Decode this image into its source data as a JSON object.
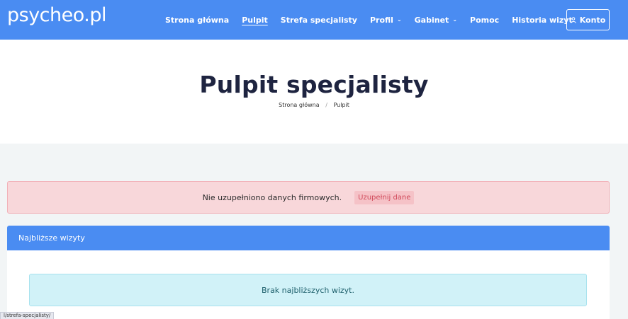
{
  "navbar": {
    "logo": "psycheo.pl",
    "links": [
      {
        "label": "Strona główna",
        "active": false,
        "dropdown": false
      },
      {
        "label": "Pulpit",
        "active": true,
        "dropdown": false
      },
      {
        "label": "Strefa specjalisty",
        "active": false,
        "dropdown": false
      },
      {
        "label": "Profil",
        "active": false,
        "dropdown": true
      },
      {
        "label": "Gabinet",
        "active": false,
        "dropdown": true
      },
      {
        "label": "Pomoc",
        "active": false,
        "dropdown": false
      },
      {
        "label": "Historia wizyt",
        "active": false,
        "dropdown": false
      }
    ],
    "account_label": "Konto",
    "account_icon": "user-icon",
    "dropdown_icon": "chevron-down-icon"
  },
  "hero": {
    "title": "Pulpit specjalisty",
    "breadcrumb": [
      "Strona główna",
      "Pulpit"
    ],
    "breadcrumb_separator": "/"
  },
  "alert": {
    "text": "Nie uzupełniono danych firmowych.",
    "action_label": "Uzupełnij dane"
  },
  "upcoming": {
    "header": "Najbliższe wizyty",
    "empty_text": "Brak najbliższych wizyt."
  },
  "status_bar": {
    "url": "l/strefa-specjalisty/"
  },
  "colors": {
    "brand_blue": "#4a8cf2",
    "danger_bg": "#f8d7da",
    "info_bg": "#d1f2f8",
    "page_bg": "#f2f5f6"
  }
}
